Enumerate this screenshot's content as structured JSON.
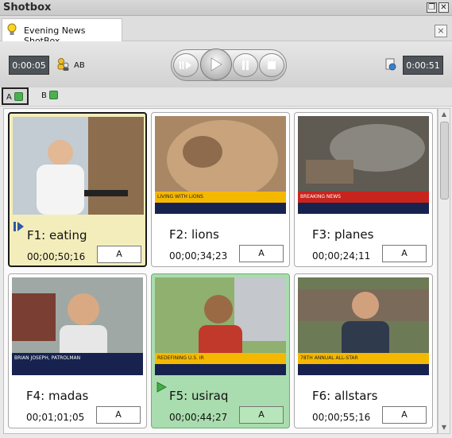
{
  "window": {
    "title": "Shotbox"
  },
  "tab": {
    "label": "Evening News ShotBox",
    "close": "×"
  },
  "toolbar": {
    "elapsed": "0:00:05",
    "ab_label": "AB",
    "remaining": "0:00:51"
  },
  "ab_tabs": [
    {
      "label": "A"
    },
    {
      "label": "B"
    }
  ],
  "clips": [
    {
      "name": "F1: eating",
      "timecode": "00;00;50;16",
      "slot": "A",
      "state": "selected"
    },
    {
      "name": "F2: lions",
      "timecode": "00;00;34;23",
      "slot": "A",
      "state": "normal",
      "caption": "LIVING WITH LIONS"
    },
    {
      "name": "F3: planes",
      "timecode": "00;00;24;11",
      "slot": "A",
      "state": "normal",
      "caption": "BREAKING NEWS"
    },
    {
      "name": "F4: madas",
      "timecode": "00;01;01;05",
      "slot": "A",
      "state": "normal",
      "caption": "BRIAN JOSEPH, PATROLMAN"
    },
    {
      "name": "F5: usiraq",
      "timecode": "00;00;44;27",
      "slot": "A",
      "state": "playing",
      "caption": "REDEFINING U.S. IR"
    },
    {
      "name": "F6: allstars",
      "timecode": "00;00;55;16",
      "slot": "A",
      "state": "normal",
      "caption": "78TH ANNUAL ALL-STAR"
    }
  ],
  "colors": {
    "selected_card": "#f3edbb",
    "playing_card": "#a9dcae",
    "time_box": "#4d5358",
    "ticker_bar": "#f5b800"
  }
}
